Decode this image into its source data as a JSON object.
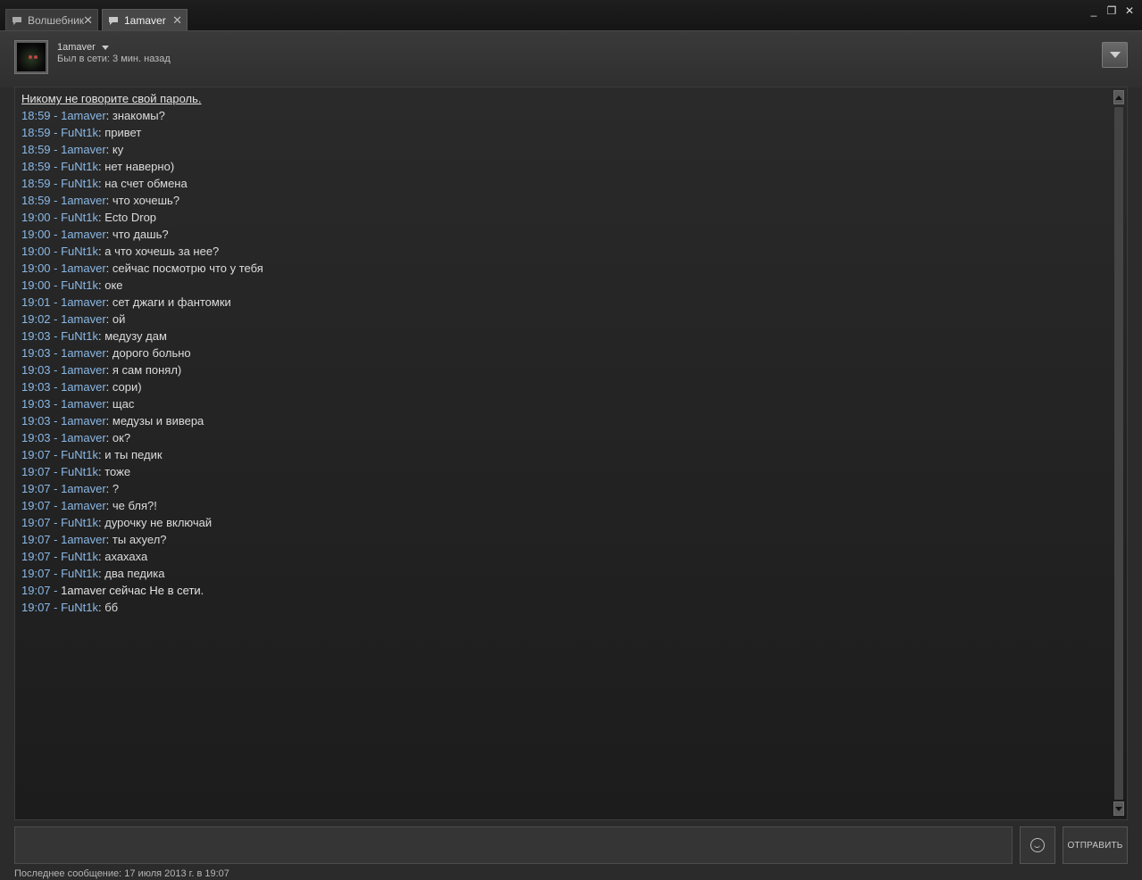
{
  "tabs": [
    {
      "label": "Волшебник",
      "active": false
    },
    {
      "label": "1amaver",
      "active": true
    }
  ],
  "window_controls": {
    "minimize": "_",
    "restore": "❐",
    "close": "✕"
  },
  "header": {
    "username": "1amaver",
    "status": "Был в сети: 3 мин. назад"
  },
  "chat": {
    "warning": "Никому не говорите свой пароль.",
    "messages": [
      {
        "meta": "18:59 - 1amaver",
        "text": "знакомы?"
      },
      {
        "meta": "18:59 - FuNt1k",
        "text": "привет"
      },
      {
        "meta": "18:59 - 1amaver",
        "text": "ку"
      },
      {
        "meta": "18:59 - FuNt1k",
        "text": "нет наверно)"
      },
      {
        "meta": "18:59 - FuNt1k",
        "text": "на счет обмена"
      },
      {
        "meta": "18:59 - 1amaver",
        "text": "что хочешь?"
      },
      {
        "meta": "19:00 - FuNt1k",
        "text": "Ecto Drop"
      },
      {
        "meta": "19:00 - 1amaver",
        "text": "что дашь?"
      },
      {
        "meta": "19:00 - FuNt1k",
        "text": "а что хочешь за нее?"
      },
      {
        "meta": "19:00 - 1amaver",
        "text": "сейчас посмотрю что у тебя"
      },
      {
        "meta": "19:00 - FuNt1k",
        "text": "оке"
      },
      {
        "meta": "19:01 - 1amaver",
        "text": "сет джаги и фантомки"
      },
      {
        "meta": "19:02 - 1amaver",
        "text": "ой"
      },
      {
        "meta": "19:03 - FuNt1k",
        "text": "медузу дам"
      },
      {
        "meta": "19:03 - 1amaver",
        "text": "дорого больно"
      },
      {
        "meta": "19:03 - 1amaver",
        "text": "я сам понял)"
      },
      {
        "meta": "19:03 - 1amaver",
        "text": "сори)"
      },
      {
        "meta": "19:03 - 1amaver",
        "text": "щас"
      },
      {
        "meta": "19:03 - 1amaver",
        "text": "медузы и вивера"
      },
      {
        "meta": "19:03 - 1amaver",
        "text": "ок?"
      },
      {
        "meta": "19:07 - FuNt1k",
        "text": "и ты педик"
      },
      {
        "meta": "19:07 - FuNt1k",
        "text": "тоже"
      },
      {
        "meta": "19:07 - 1amaver",
        "text": "?"
      },
      {
        "meta": "19:07 - 1amaver",
        "text": "че бля?!"
      },
      {
        "meta": "19:07 - FuNt1k",
        "text": "дурочку не включай"
      },
      {
        "meta": "19:07 - 1amaver",
        "text": "ты ахуел?"
      },
      {
        "meta": "19:07 - FuNt1k",
        "text": "ахахаха"
      },
      {
        "meta": "19:07 - FuNt1k",
        "text": "два педика"
      },
      {
        "meta": "19:07 -",
        "text": "1amaver сейчас Не в сети.",
        "system": true
      },
      {
        "meta": "19:07 - FuNt1k",
        "text": "бб"
      }
    ]
  },
  "input": {
    "placeholder": ""
  },
  "send_label": "ОТПРАВИТЬ",
  "footer": "Последнее сообщение: 17 июля 2013 г. в 19:07",
  "colors": {
    "name_color": "#8ab8e6",
    "text_color": "#dcdcdc",
    "background": "#2b2b2b"
  }
}
